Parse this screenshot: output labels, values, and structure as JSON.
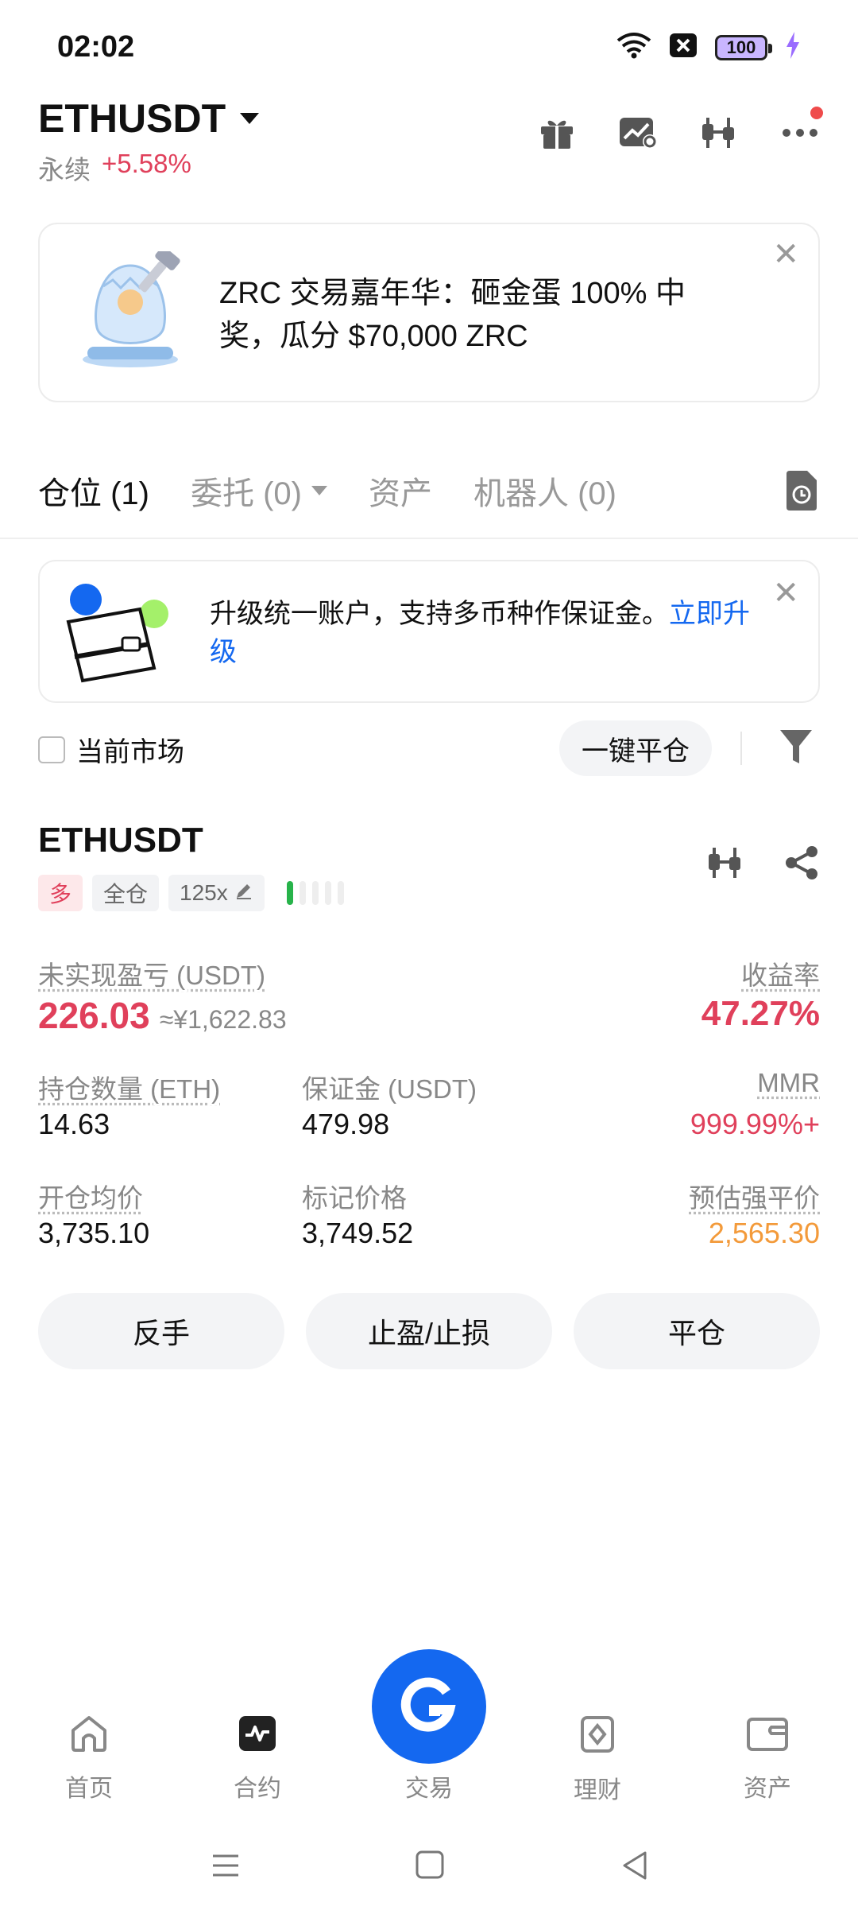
{
  "status_bar": {
    "time": "02:02",
    "battery": "100"
  },
  "header": {
    "symbol": "ETHUSDT",
    "contract_type": "永续",
    "change": "+5.58%",
    "icons": [
      "gift-icon",
      "chart-settings-icon",
      "candlestick-icon",
      "more-icon"
    ]
  },
  "promo_banner": {
    "text": "ZRC 交易嘉年华：砸金蛋 100% 中奖，瓜分 $70,000 ZRC"
  },
  "tabs": [
    {
      "label": "仓位 (1)"
    },
    {
      "label": "委托 (0)"
    },
    {
      "label": "资产"
    },
    {
      "label": "机器人 (0)"
    }
  ],
  "notice": {
    "text": "升级统一账户，支持多币种作保证金。",
    "link": "立即升级"
  },
  "filters": {
    "current_market_label": "当前市场",
    "close_all_label": "一键平仓"
  },
  "position": {
    "symbol": "ETHUSDT",
    "side_tag": "多",
    "margin_mode_tag": "全仓",
    "leverage_tag": "125x",
    "adl_level": 1,
    "unrealized_pnl_label": "未实现盈亏 (USDT)",
    "unrealized_pnl": "226.03",
    "unrealized_pnl_cny": "≈¥1,622.83",
    "roe_label": "收益率",
    "roe": "47.27%",
    "size_label": "持仓数量 (ETH)",
    "size": "14.63",
    "margin_label": "保证金 (USDT)",
    "margin": "479.98",
    "mmr_label": "MMR",
    "mmr": "999.99%+",
    "entry_price_label": "开仓均价",
    "entry_price": "3,735.10",
    "mark_price_label": "标记价格",
    "mark_price": "3,749.52",
    "liq_price_label": "预估强平价",
    "liq_price": "2,565.30",
    "actions": {
      "reverse": "反手",
      "tpsl": "止盈/止损",
      "close": "平仓"
    }
  },
  "bottom_nav": {
    "home": "首页",
    "futures": "合约",
    "trade": "交易",
    "earn": "理财",
    "assets": "资产"
  },
  "colors": {
    "accent": "#1468f0",
    "up": "#e0405b",
    "warning": "#f39a3a"
  }
}
